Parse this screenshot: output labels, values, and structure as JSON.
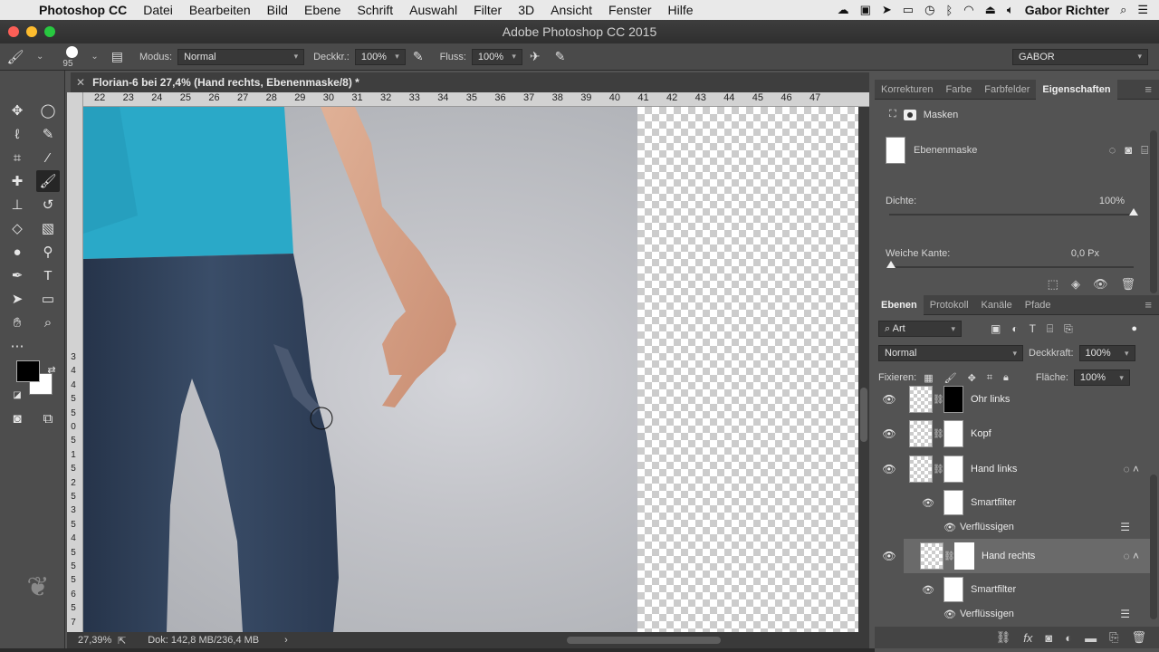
{
  "menubar": {
    "apple": "",
    "items": [
      "Photoshop CC",
      "Datei",
      "Bearbeiten",
      "Bild",
      "Ebene",
      "Schrift",
      "Auswahl",
      "Filter",
      "3D",
      "Ansicht",
      "Fenster",
      "Hilfe"
    ],
    "user": "Gabor Richter"
  },
  "window": {
    "title": "Adobe Photoshop CC 2015"
  },
  "options": {
    "brush_size": "95",
    "mode_label": "Modus:",
    "mode_value": "Normal",
    "opacity_label": "Deckkr.:",
    "opacity_value": "100%",
    "flow_label": "Fluss:",
    "flow_value": "100%",
    "workspace": "GABOR"
  },
  "document": {
    "tab_title": "Florian-6 bei 27,4% (Hand rechts, Ebenenmaske/8) *",
    "ruler_h": [
      "22",
      "23",
      "24",
      "25",
      "26",
      "27",
      "28",
      "29",
      "30",
      "31",
      "32",
      "33",
      "34",
      "35",
      "36",
      "37",
      "38",
      "39",
      "40",
      "41",
      "42",
      "43",
      "44",
      "45",
      "46",
      "47"
    ],
    "ruler_v": [
      "3",
      "4",
      "4",
      "5",
      "5",
      "0",
      "5",
      "1",
      "5",
      "2",
      "5",
      "3",
      "5",
      "4",
      "5",
      "5",
      "5",
      "6",
      "5",
      "7"
    ],
    "zoom": "27,39%",
    "doc_info": "Dok: 142,8 MB/236,4 MB"
  },
  "properties": {
    "tabs": [
      "Korrekturen",
      "Farbe",
      "Farbfelder",
      "Eigenschaften"
    ],
    "active_tab": 3,
    "section": "Masken",
    "mask_name": "Ebenenmaske",
    "density_label": "Dichte:",
    "density_value": "100%",
    "density_fraction": 1.0,
    "feather_label": "Weiche Kante:",
    "feather_value": "0,0 Px",
    "feather_fraction": 0.0
  },
  "layers_panel": {
    "tabs": [
      "Ebenen",
      "Protokoll",
      "Kanäle",
      "Pfade"
    ],
    "active_tab": 0,
    "filter_kind": "Art",
    "blend_mode": "Normal",
    "opacity_label": "Deckkraft:",
    "opacity_value": "100%",
    "lock_label": "Fixieren:",
    "fill_label": "Fläche:",
    "fill_value": "100%",
    "layers": [
      {
        "name": "Ohr links",
        "mask": "black"
      },
      {
        "name": "Kopf",
        "mask": "white"
      },
      {
        "name": "Hand links",
        "mask": "white",
        "smart": true
      },
      {
        "name": "Smartfilter"
      },
      {
        "name": "Verflüssigen"
      },
      {
        "name": "Hand rechts",
        "mask": "white",
        "smart": true,
        "selected": true
      },
      {
        "name": "Smartfilter"
      },
      {
        "name": "Verflüssigen"
      }
    ]
  }
}
